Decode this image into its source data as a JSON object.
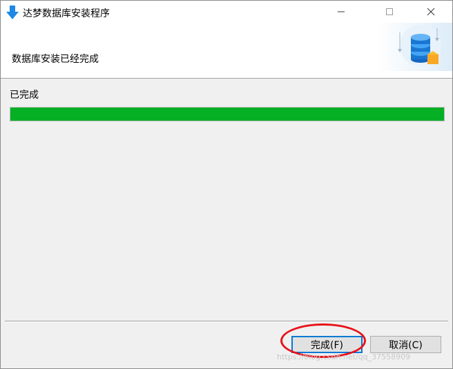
{
  "window": {
    "title": "达梦数据库安装程序",
    "icon": "download-arrow-icon"
  },
  "header": {
    "title": "数据库安装已经完成",
    "graphic": "database-stack-icon"
  },
  "status": {
    "label": "已完成",
    "progress_percent": 100,
    "progress_color": "#06b025"
  },
  "buttons": {
    "finish_label": "完成(F)",
    "cancel_label": "取消(C)"
  },
  "annotation": {
    "ring_color": "#e8121a"
  },
  "watermark": "https://blog.csdn.net/qq_37558909"
}
